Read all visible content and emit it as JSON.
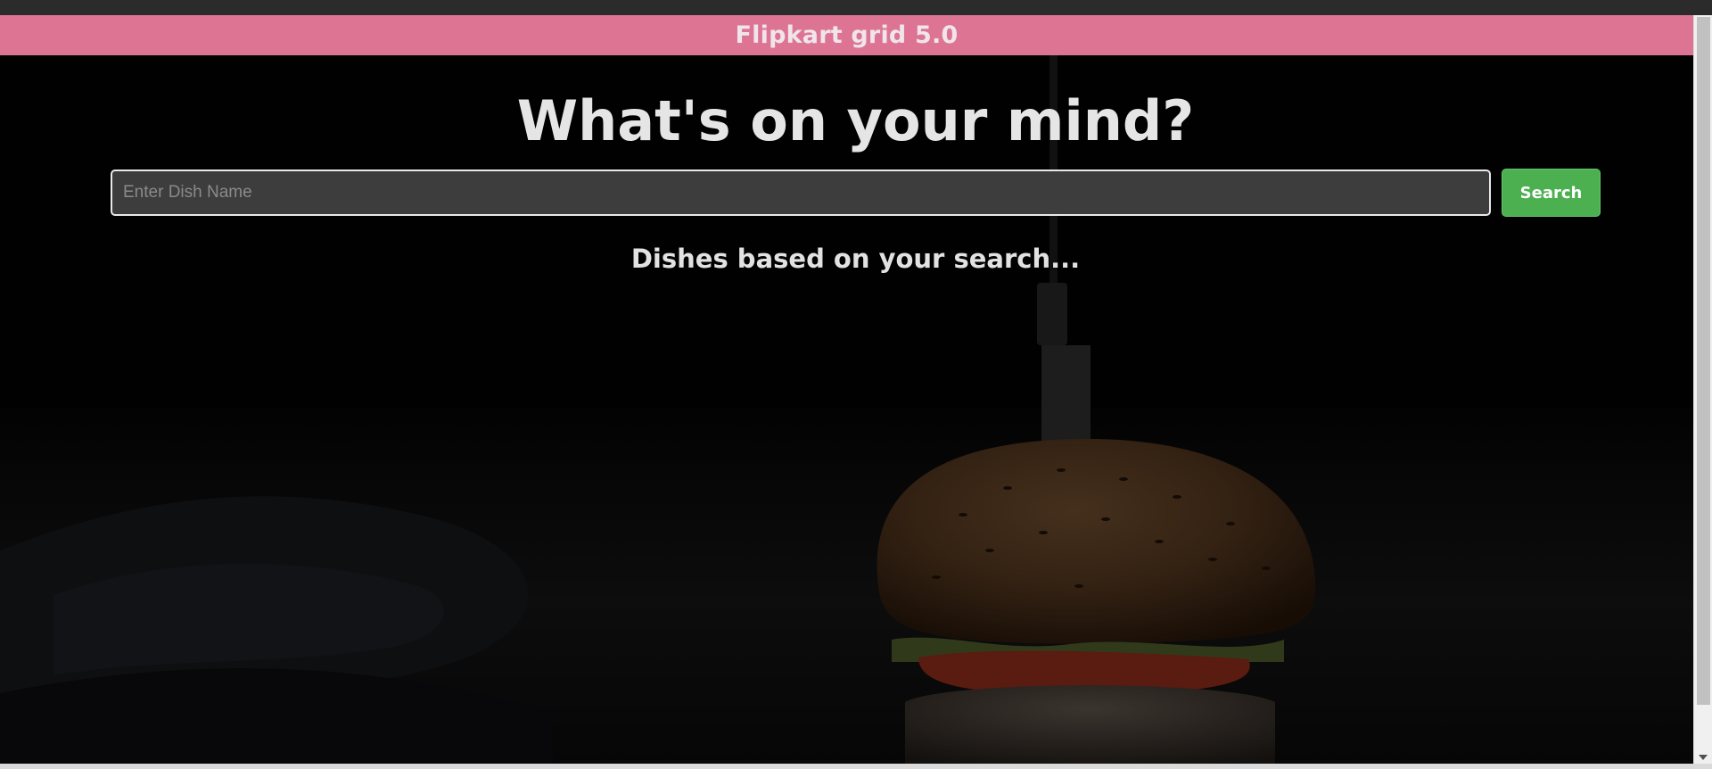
{
  "navbar": {
    "title": "Flipkart grid 5.0",
    "background_color": "#dd7493"
  },
  "hero": {
    "title": "What's on your mind?"
  },
  "search": {
    "placeholder": "Enter Dish Name",
    "value": "",
    "button_label": "Search",
    "button_color": "#4caf50"
  },
  "results": {
    "heading": "Dishes based on your search..."
  },
  "background": {
    "image": "burger-photo"
  }
}
